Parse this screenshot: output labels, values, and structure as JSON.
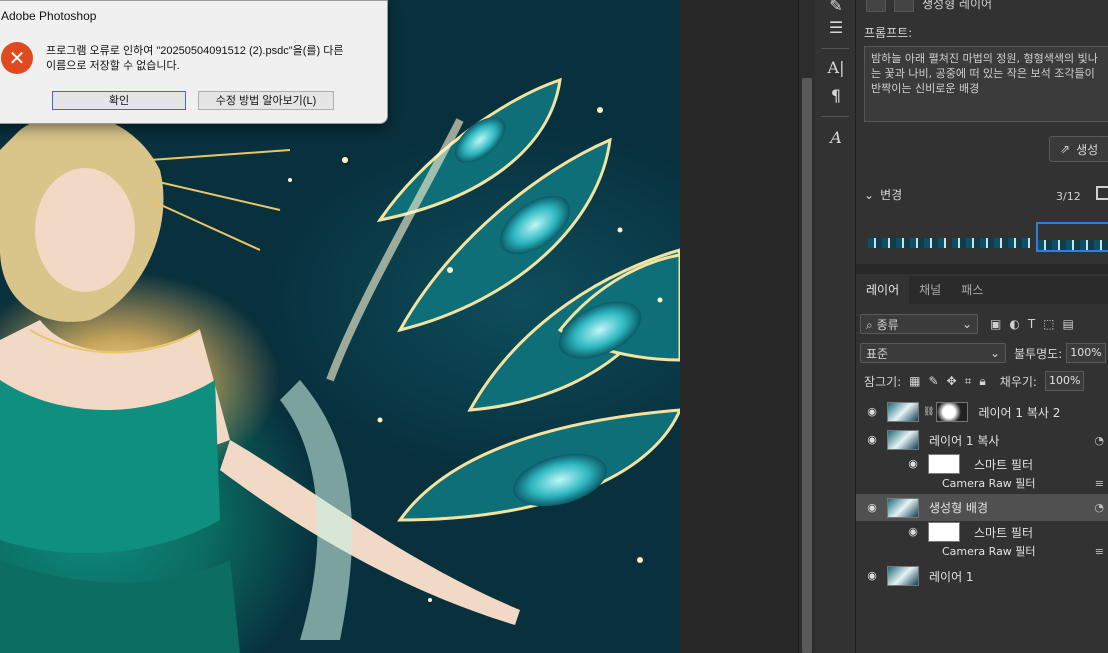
{
  "dialog": {
    "title": "Adobe Photoshop",
    "message_line1": "프로그램 오류로 인하여 \"20250504091512 (2).psdc\"을(를) 다른",
    "message_line2": "이름으로 저장할 수 없습니다.",
    "ok_label": "확인",
    "help_label": "수정 방법 알아보기(L)",
    "error_icon": "x-circle-icon",
    "accent_color": "#e04a1f"
  },
  "generative": {
    "header_label": "생성형 레이어",
    "prompt_label": "프롬프트:",
    "prompt_text": "밤하늘 아래 펼쳐진 마법의 정원, 형형색색의 빛나는 꽃과 나비, 공중에 떠 있는 작은 보석 조각들이 반짝이는 신비로운 배경",
    "generate_label": "생성",
    "variations_label": "변경",
    "variations_count": "3/12"
  },
  "layers_panel": {
    "tabs": [
      {
        "label": "레이어",
        "active": true
      },
      {
        "label": "채널",
        "active": false
      },
      {
        "label": "패스",
        "active": false
      }
    ],
    "filter_value": "종류",
    "blend_mode": "표준",
    "opacity_label": "불투명도:",
    "opacity_value": "100%",
    "lock_label": "잠그기:",
    "fill_label": "채우기:",
    "fill_value": "100%",
    "layers": [
      {
        "name": "레이어 1 복사 2"
      },
      {
        "name": "레이어 1 복사"
      },
      {
        "name": "스마트 필터"
      },
      {
        "name": "Camera Raw 필터"
      },
      {
        "name": "생성형 배경"
      },
      {
        "name": "스마트 필터"
      },
      {
        "name": "Camera Raw 필터"
      },
      {
        "name": "레이어 1"
      }
    ]
  }
}
